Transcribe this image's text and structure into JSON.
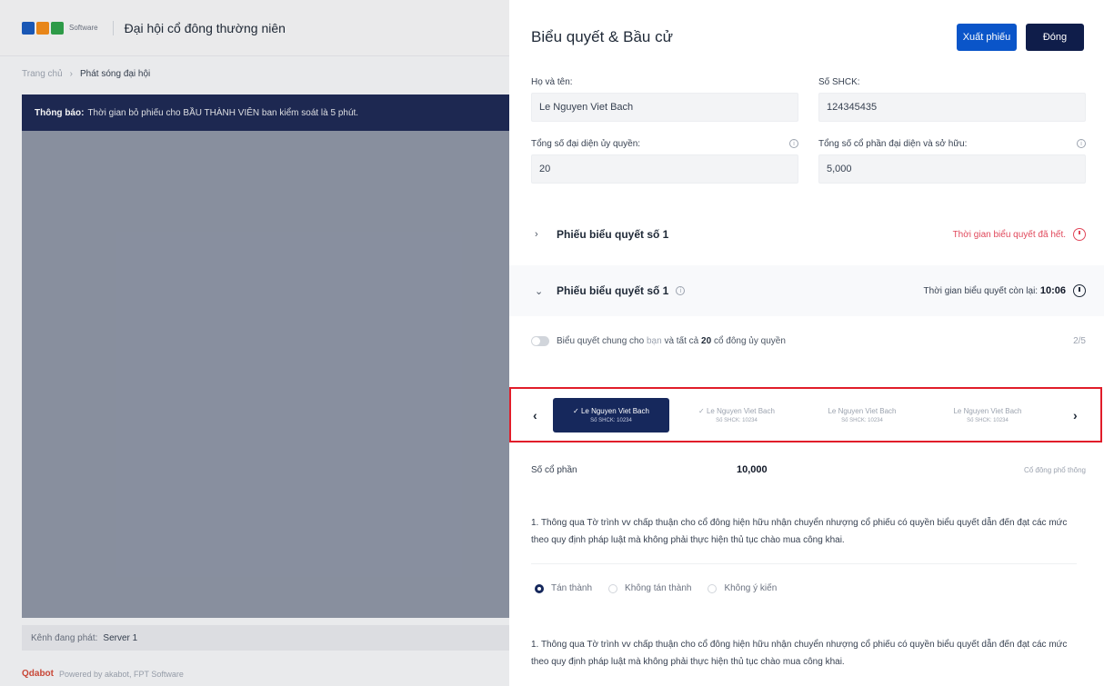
{
  "background": {
    "logo_text": "Software",
    "title": "Đại hội cổ đông thường niên",
    "breadcrumb": [
      "Trang chủ",
      "Phát sóng đại hội"
    ],
    "notice_label": "Thông báo:",
    "notice_text": "Thời gian bỏ phiếu cho BẦU THÀNH VIÊN ban kiểm soát là 5 phút.",
    "channel_label": "Kênh đang phát:",
    "channel_value": "Server 1",
    "footer_brand": "Qdabot",
    "footer_text": "Powered by akabot, FPT Software"
  },
  "drawer": {
    "title": "Biểu quyết & Bầu cử",
    "export_label": "Xuất phiếu",
    "close_label": "Đóng",
    "fields": {
      "name_label": "Họ và tên:",
      "name_value": "Le Nguyen Viet Bach",
      "shck_label": "Số SHCK:",
      "shck_value": "124345435",
      "proxy_label": "Tổng số đại diện ủy quyền:",
      "proxy_value": "20",
      "shares_label": "Tổng số cổ phần đại diện và sở hữu:",
      "shares_value": "5,000"
    },
    "ballot1": {
      "title": "Phiếu biểu quyết số 1",
      "status": "Thời gian biểu quyết đã hết."
    },
    "ballot2": {
      "title": "Phiếu biểu quyết số 1",
      "remain_label": "Thời gian biểu quyết còn lại:",
      "remain_value": "10:06"
    },
    "toggle": {
      "pre": "Biểu quyết chung cho",
      "highlight": "bạn",
      "mid": "và tất cả",
      "count": "20",
      "post": "cổ đông ủy quyền",
      "progress": "2/5"
    },
    "shareholders": [
      {
        "name": "✓ Le Nguyen Viet Bach",
        "sub": "Số SHCK: 10234",
        "active": true
      },
      {
        "name": "✓ Le Nguyen Viet Bach",
        "sub": "Số SHCK: 10234",
        "active": false
      },
      {
        "name": "Le Nguyen Viet Bach",
        "sub": "Số SHCK: 10234",
        "active": false
      },
      {
        "name": "Le Nguyen Viet Bach",
        "sub": "Số SHCK: 10234",
        "active": false
      }
    ],
    "share_label": "Số cổ phần",
    "share_value": "10,000",
    "share_note": "Cổ đông phổ thông",
    "question1": "1. Thông qua Tờ trình vv chấp thuận cho cổ đông hiện hữu nhận chuyển nhượng cổ phiếu có quyền biểu quyết dẫn đến đạt các mức theo quy định pháp luật mà không phải thực hiện thủ tục chào mua công khai.",
    "options": [
      "Tán thành",
      "Không tán thành",
      "Không ý kiến"
    ],
    "selected_option": "Tán thành",
    "question2": "1. Thông qua Tờ trình vv chấp thuận cho cổ đông hiện hữu nhận chuyển nhượng cổ phiếu có quyền biểu quyết dẫn đến đạt các mức theo quy định pháp luật mà không phải thực hiện thủ tục chào mua công khai.",
    "colors": {
      "primary": "#0a55c9",
      "dark": "#0f1d4a",
      "alert": "#e0475a",
      "highlight_border": "#e11d2a"
    }
  }
}
